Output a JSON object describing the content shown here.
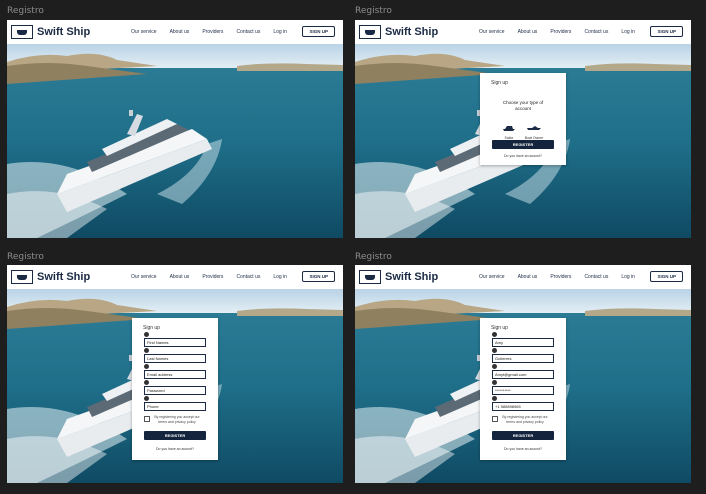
{
  "frame_label": "Registro",
  "nav": {
    "brand": "Swift Ship",
    "links": [
      "Our service",
      "About us",
      "Providers",
      "Contact us",
      "Log in"
    ],
    "signup": "SIGN UP"
  },
  "account_modal": {
    "title": "Sign up",
    "heading": "Choose your type of account",
    "options": [
      {
        "label": "Sailor",
        "icon": "yacht-icon"
      },
      {
        "label": "Boat Owner",
        "icon": "speedboat-icon"
      }
    ],
    "register": "REGISTER",
    "login_link": "Do you have an acount?"
  },
  "empty_form": {
    "title": "Sign up",
    "fields": [
      {
        "icon": "user-icon",
        "value": "First Names"
      },
      {
        "icon": "user-icon",
        "value": "Last Names"
      },
      {
        "icon": "mail-icon",
        "value": "Email address"
      },
      {
        "icon": "lock-icon",
        "value": "Password"
      },
      {
        "icon": "phone-icon",
        "value": "Phone"
      }
    ],
    "terms": "By registering you accept our terms and privacy policy",
    "register": "REGISTER",
    "login_link": "Do you have an acount?"
  },
  "filled_form": {
    "title": "Sign up",
    "fields": [
      {
        "icon": "user-icon",
        "value": "Amy"
      },
      {
        "icon": "user-icon",
        "value": "Gutierres"
      },
      {
        "icon": "mail-icon",
        "value": "Amyt@gmail.com"
      },
      {
        "icon": "lock-icon",
        "value": "**********"
      },
      {
        "icon": "phone-icon",
        "value": "+1 585898965"
      }
    ],
    "terms": "By registering you accept our terms and privacy policy",
    "register": "REGISTER",
    "login_link": "Do you have an acount?"
  },
  "colors": {
    "brand": "#1b2a44",
    "button": "#14243d",
    "canvas": "#1e1e1e"
  }
}
